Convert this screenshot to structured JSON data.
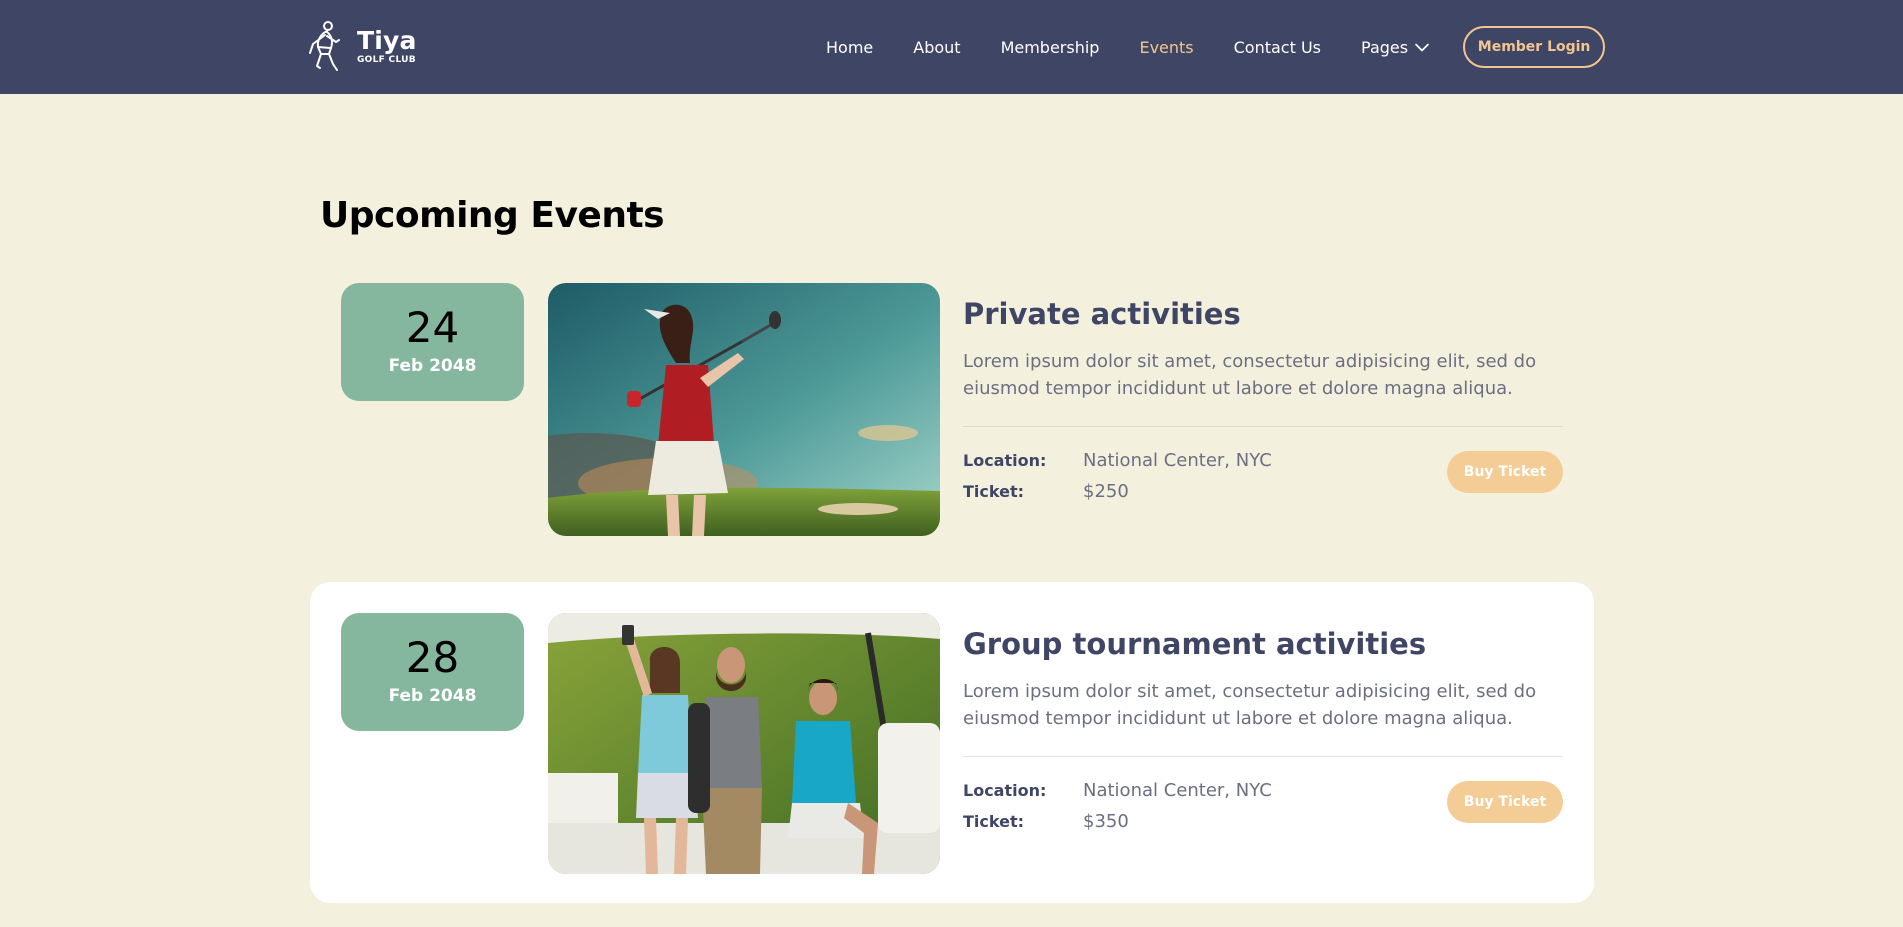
{
  "brand": {
    "name": "Tiya",
    "tagline": "GOLF CLUB",
    "logo_icon": "golfer-swing-icon"
  },
  "nav": {
    "items": [
      {
        "label": "Home",
        "active": false
      },
      {
        "label": "About",
        "active": false
      },
      {
        "label": "Membership",
        "active": false
      },
      {
        "label": "Events",
        "active": true
      },
      {
        "label": "Contact Us",
        "active": false
      }
    ],
    "pages_label": "Pages",
    "login_label": "Member Login"
  },
  "section": {
    "title": "Upcoming Events"
  },
  "labels": {
    "location": "Location:",
    "ticket": "Ticket:",
    "buy": "Buy Ticket"
  },
  "events": [
    {
      "day": "24",
      "month": "Feb 2048",
      "title": "Private activities",
      "description": "Lorem ipsum dolor sit amet, consectetur adipisicing elit, sed do eiusmod tempor incididunt ut labore et dolore magna aliqua.",
      "location": "National Center, NYC",
      "price": "$250",
      "photo": "woman-golfer-swing-photo"
    },
    {
      "day": "28",
      "month": "Feb 2048",
      "title": "Group tournament activities",
      "description": "Lorem ipsum dolor sit amet, consectetur adipisicing elit, sed do eiusmod tempor incididunt ut labore et dolore magna aliqua.",
      "location": "National Center, NYC",
      "price": "$350",
      "photo": "golfers-selfie-golf-cart-photo"
    }
  ],
  "colors": {
    "header_bg": "#3F4565",
    "page_bg": "#F4F0DE",
    "accent": "#F2C78F",
    "date_badge": "#85B69E",
    "button": "#F4CC95"
  }
}
